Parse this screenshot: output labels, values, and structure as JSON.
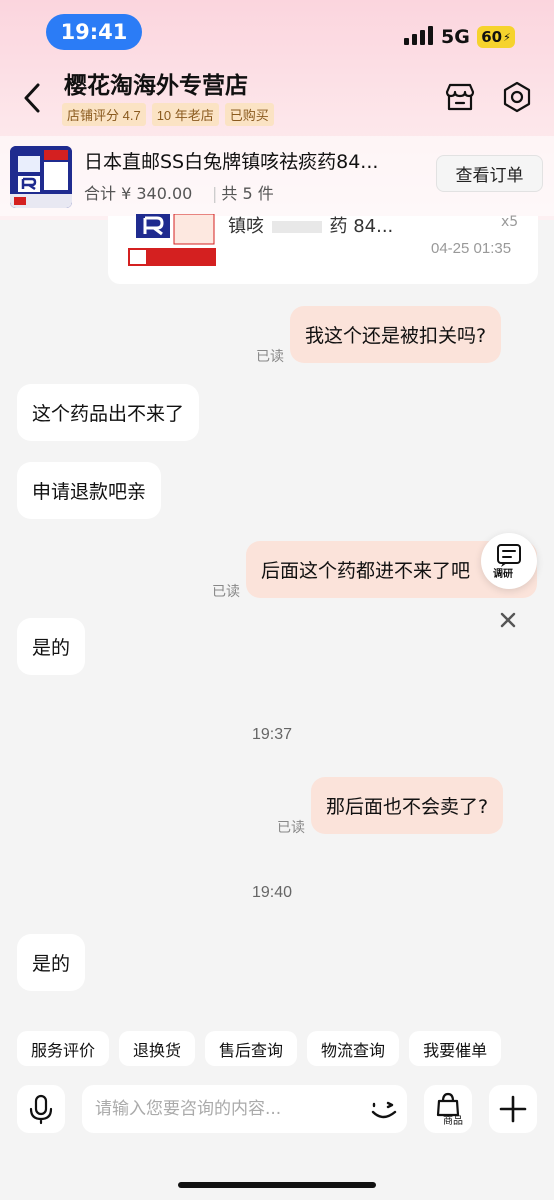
{
  "status_bar": {
    "time": "19:41",
    "network": "5G",
    "battery": "60"
  },
  "header": {
    "shop_name": "樱花淘海外专营店",
    "tags": [
      "店铺评分 4.7",
      "10 年老店",
      "已购买"
    ]
  },
  "order": {
    "title": "日本直邮SS白兔牌镇咳祛痰药84...",
    "total": "合计 ¥ 340.00",
    "count": "共 5 件",
    "view_button": "查看订单"
  },
  "prev_card": {
    "text": "镇咳",
    "text_tail": "药 84...",
    "qty": "x5",
    "time": "04-25 01:35"
  },
  "messages": [
    {
      "side": "right",
      "text": "我这个还是被扣关吗?",
      "read": "已读"
    },
    {
      "side": "left",
      "text": "这个药品出不来了"
    },
    {
      "side": "left",
      "text": "申请退款吧亲"
    },
    {
      "side": "right",
      "text": "后面这个药都进不来了吧",
      "read": "已读"
    },
    {
      "side": "left",
      "text": "是的"
    },
    {
      "side": "time",
      "text": "19:37"
    },
    {
      "side": "right",
      "text": "那后面也不会卖了?",
      "read": "已读"
    },
    {
      "side": "time",
      "text": "19:40"
    },
    {
      "side": "left",
      "text": "是的"
    }
  ],
  "survey": {
    "label": "调研"
  },
  "quick_replies": [
    "服务评价",
    "退换货",
    "售后查询",
    "物流查询",
    "我要催单"
  ],
  "input": {
    "placeholder": "请输入您要咨询的内容...",
    "product_label": "商品"
  },
  "colors": {
    "accent_blue": "#2b7cf6",
    "bubble_right": "#fbe3da",
    "tag_bg": "#fbe3c4"
  }
}
